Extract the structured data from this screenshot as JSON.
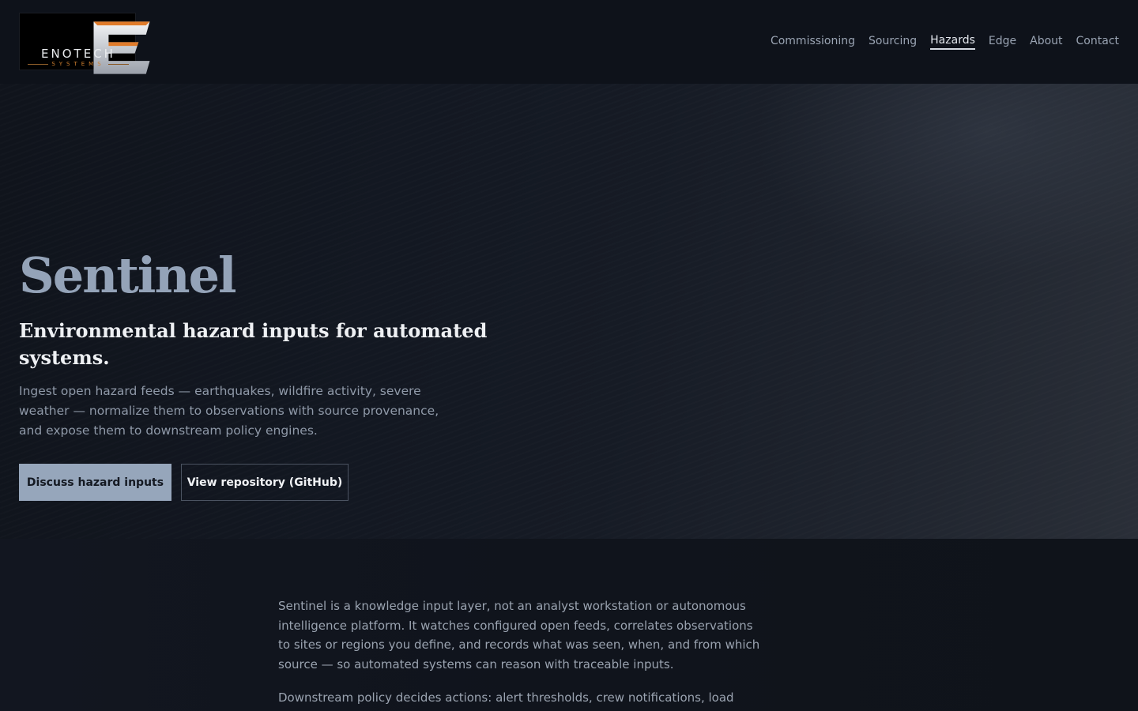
{
  "brand": {
    "name": "ENOTECH",
    "tagline": "SYSTEMS",
    "accent_color": "#d2812f"
  },
  "nav": {
    "items": [
      {
        "label": "Commissioning",
        "active": false
      },
      {
        "label": "Sourcing",
        "active": false
      },
      {
        "label": "Hazards",
        "active": true
      },
      {
        "label": "Edge",
        "active": false
      },
      {
        "label": "About",
        "active": false
      },
      {
        "label": "Contact",
        "active": false
      }
    ]
  },
  "hero": {
    "title": "Sentinel",
    "subtitle": "Environmental hazard inputs for automated systems.",
    "lede": "Ingest open hazard feeds — earthquakes, wildfire activity, severe weather — normalize them to observations with source provenance, and expose them to downstream policy engines.",
    "primary_cta": "Discuss hazard inputs",
    "secondary_cta": "View repository (GitHub)",
    "title_color": "#94a3b8",
    "primary_cta_color": "#96a6bb"
  },
  "about": {
    "paragraph_1": "Sentinel is a knowledge input layer, not an analyst workstation or autonomous intelligence platform. It watches configured open feeds, correlates observations to sites or regions you define, and records what was seen, when, and from which source — so automated systems can reason with traceable inputs.",
    "paragraph_2": "Downstream policy decides actions: alert thresholds, crew notifications, load"
  }
}
